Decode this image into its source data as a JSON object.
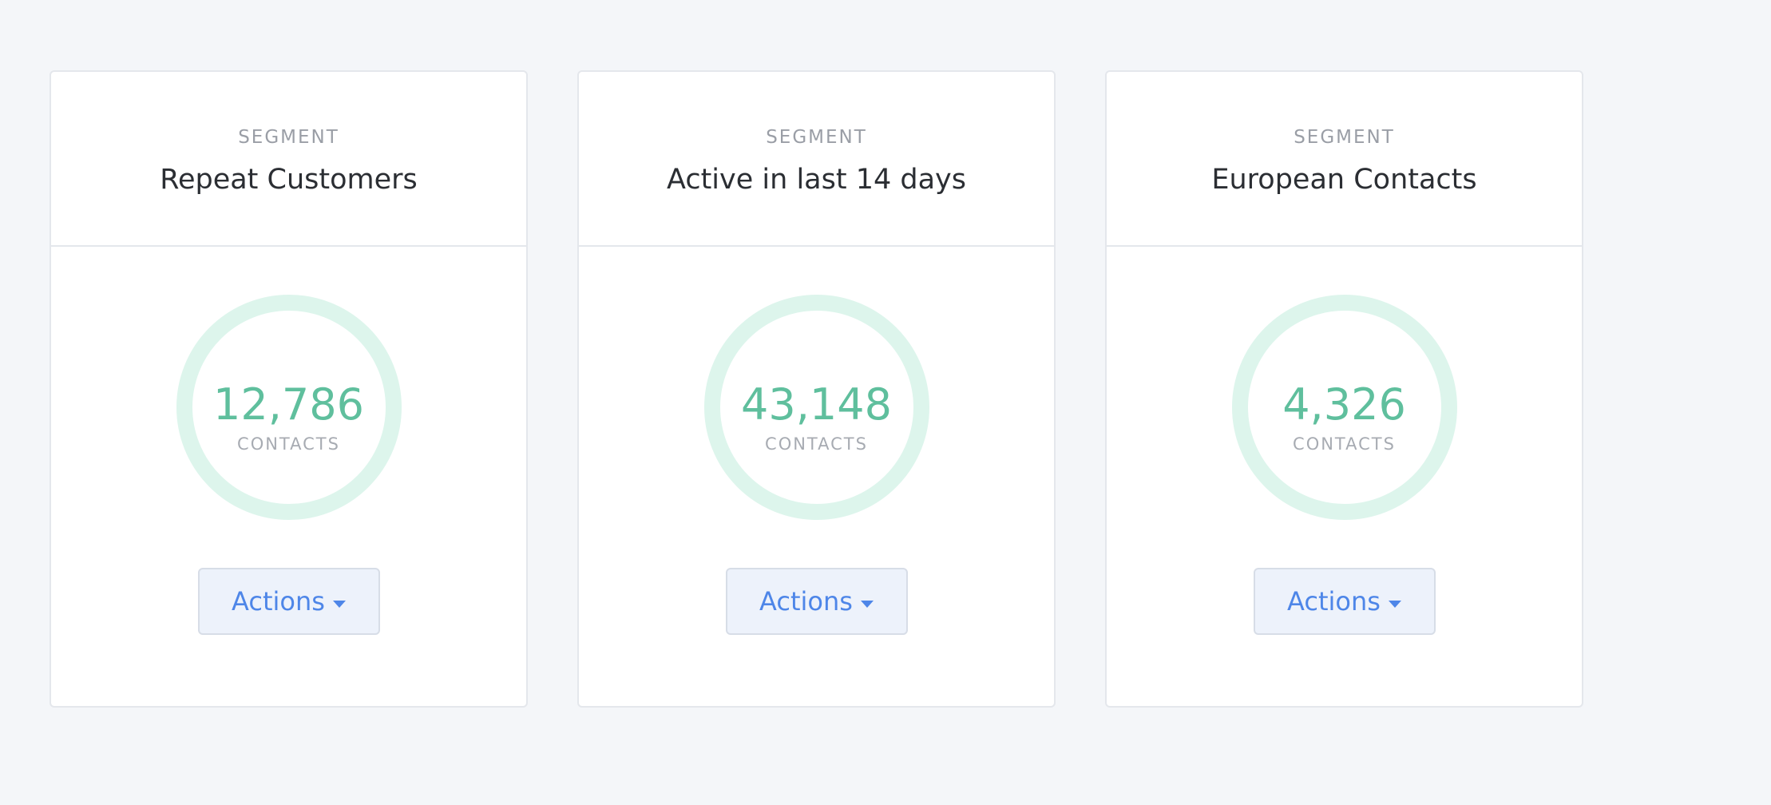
{
  "colors": {
    "page_background": "#f4f6f9",
    "card_background": "#ffffff",
    "ring": "#ddf5ec",
    "count": "#5fbf9d",
    "button_text": "#4e86e8",
    "button_background": "#edf2fb"
  },
  "cards": [
    {
      "eyebrow": "SEGMENT",
      "title": "Repeat Customers",
      "count": "12,786",
      "count_label": "CONTACTS",
      "action_label": "Actions",
      "action_icon": "caret-down-icon"
    },
    {
      "eyebrow": "SEGMENT",
      "title": "Active in last 14 days",
      "count": "43,148",
      "count_label": "CONTACTS",
      "action_label": "Actions",
      "action_icon": "caret-down-icon"
    },
    {
      "eyebrow": "SEGMENT",
      "title": "European Contacts",
      "count": "4,326",
      "count_label": "CONTACTS",
      "action_label": "Actions",
      "action_icon": "caret-down-icon"
    }
  ]
}
